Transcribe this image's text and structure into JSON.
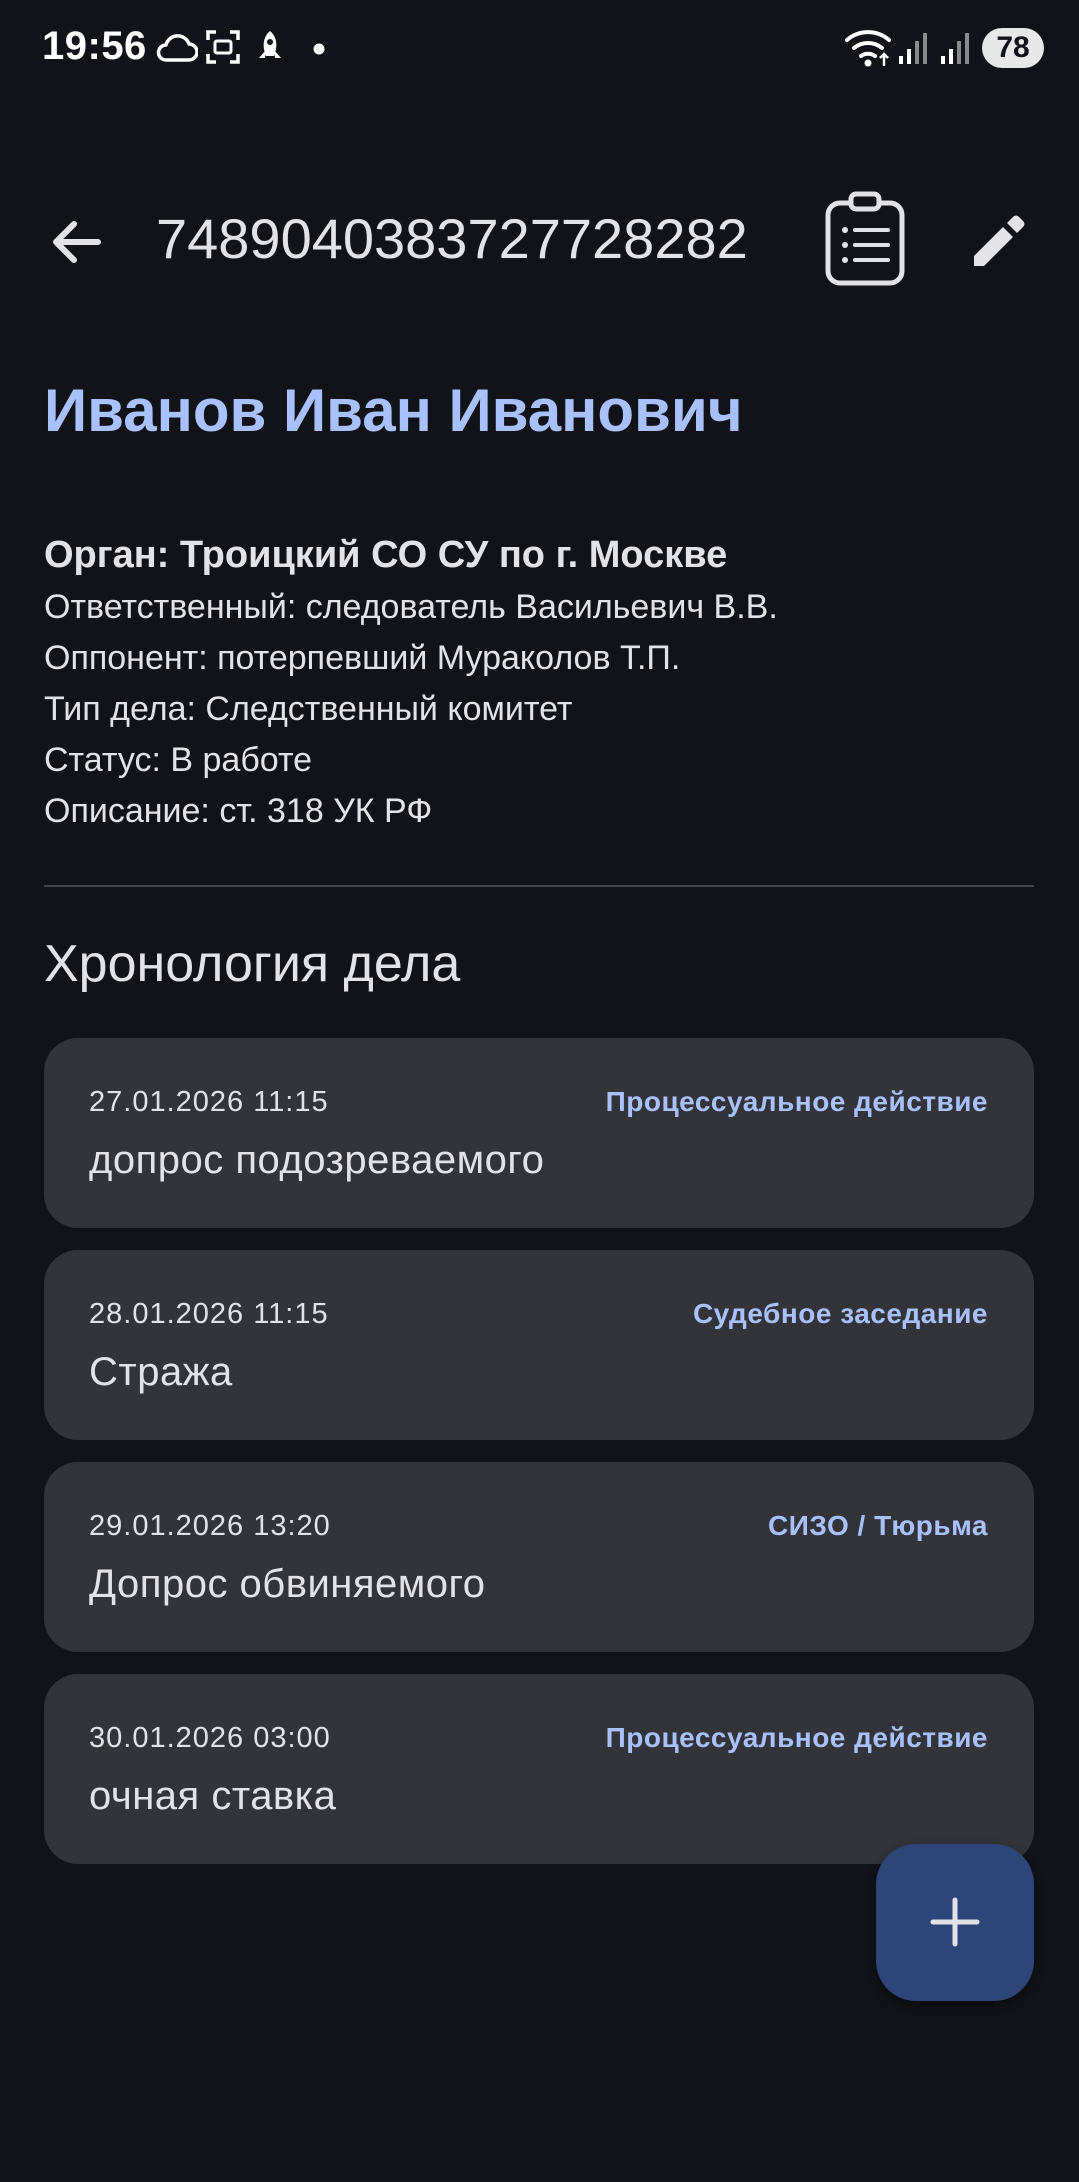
{
  "status_bar": {
    "time": "19:56",
    "battery": "78",
    "icons": [
      "cloud-icon",
      "screen-capture-icon",
      "rocket-icon",
      "dot-icon",
      "wifi-icon",
      "signal-icon",
      "signal-icon"
    ]
  },
  "app_bar": {
    "case_number": "7489040383727728282",
    "icons": [
      "arrow-back-icon",
      "clipboard-list-icon",
      "pencil-icon"
    ]
  },
  "client": {
    "name": "Иванов Иван Иванович",
    "organ": "Орган: Троицкий СО СУ по г. Москве",
    "details": [
      "Ответственный: следователь Васильевич В.В.",
      "Оппонент: потерпевший Мураколов Т.П.",
      "Тип дела: Следственный комитет",
      "Статус: В работе",
      "Описание: ст. 318 УК РФ"
    ]
  },
  "timeline": {
    "title": "Хронология дела",
    "events": [
      {
        "date": "27.01.2026 11:15",
        "type": "Процессуальное действие",
        "title": "допрос подозреваемого"
      },
      {
        "date": "28.01.2026 11:15",
        "type": "Судебное заседание",
        "title": "Стража"
      },
      {
        "date": "29.01.2026 13:20",
        "type": "СИЗО / Тюрьма",
        "title": "Допрос обвиняемого"
      },
      {
        "date": "30.01.2026 03:00",
        "type": "Процессуальное действие",
        "title": "очная ставка"
      }
    ]
  },
  "fab": {
    "icon": "plus-icon"
  },
  "colors": {
    "background": "#121318",
    "accent": "#a9c1fb",
    "card": "#33343a",
    "fab": "#2d4578",
    "text": "#e3e2e6"
  }
}
